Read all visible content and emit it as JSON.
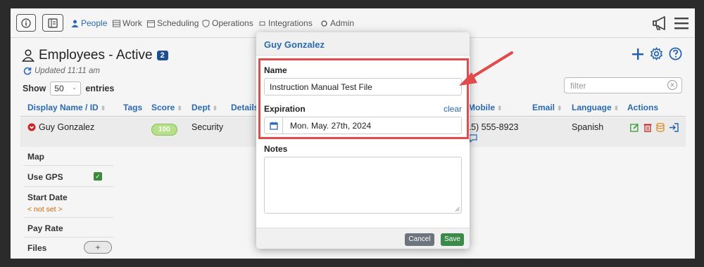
{
  "nav": {
    "items": [
      {
        "label": "People",
        "icon": "person-icon",
        "active": true
      },
      {
        "label": "Work",
        "icon": "list-icon"
      },
      {
        "label": "Scheduling",
        "icon": "calendar-icon"
      },
      {
        "label": "Operations",
        "icon": "shield-icon"
      },
      {
        "label": "Integrations",
        "icon": "plug-icon"
      },
      {
        "label": "Admin",
        "icon": "gear-icon"
      }
    ]
  },
  "page": {
    "title": "Employees - Active",
    "count": "2",
    "updated": "Updated 11:11 am",
    "show_label": "Show",
    "show_value": "50",
    "entries_label": "entries",
    "filter_placeholder": "filter"
  },
  "table": {
    "headers": [
      "Display Name / ID",
      "Tags",
      "Score",
      "Dept",
      "Details",
      "Mobile",
      "Email",
      "Language",
      "Actions"
    ],
    "row": {
      "name": "Guy Gonzalez",
      "score": "100",
      "dept": "Security",
      "mobile": "(415) 555-8923",
      "language": "Spanish"
    }
  },
  "details": {
    "map_label": "Map",
    "gps_label": "Use GPS",
    "start_label": "Start Date",
    "start_value": "< not set >",
    "pay_label": "Pay Rate",
    "files_label": "Files",
    "files_button": "+"
  },
  "modal": {
    "title": "Guy Gonzalez",
    "name_label": "Name",
    "name_value": "Instruction Manual Test File",
    "expiration_label": "Expiration",
    "clear_label": "clear",
    "expiration_value": "Mon. May. 27th, 2024",
    "notes_label": "Notes",
    "cancel_label": "Cancel",
    "save_label": "Save"
  },
  "colors": {
    "accent": "#2a6ab2",
    "highlight": "#e24b4b",
    "save": "#3a8a4a",
    "cancel": "#6c757d"
  }
}
